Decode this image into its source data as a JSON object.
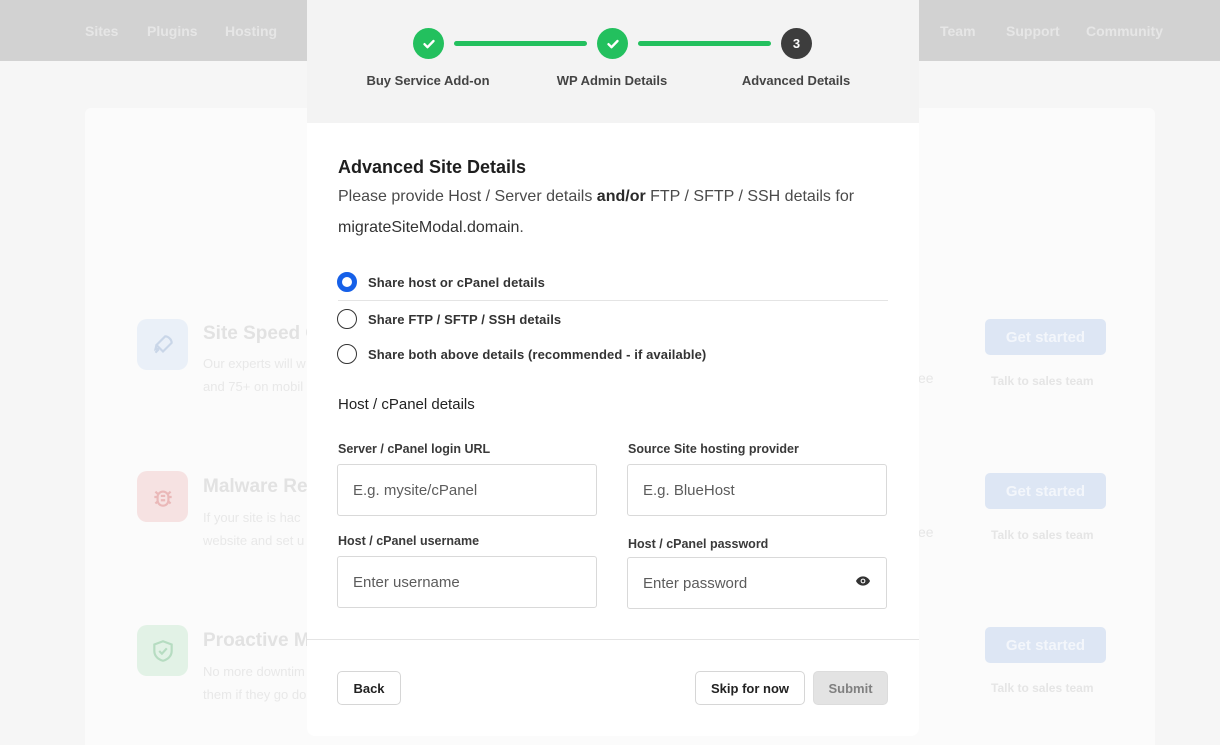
{
  "background": {
    "nav": [
      "Sites",
      "Plugins",
      "Hosting",
      "Team",
      "Support",
      "Community"
    ],
    "services": [
      {
        "title": "Site Speed O",
        "desc1": "Our experts will w",
        "desc2": "and 75+ on mobil",
        "cut": "ee",
        "icon": "rocket-icon",
        "button": "Get started",
        "talk": "Talk to sales team"
      },
      {
        "title": "Malware Rem",
        "desc1": "If your site is hac",
        "desc2": "website and set u",
        "cut": "ee",
        "icon": "bug-icon",
        "button": "Get started",
        "talk": "Talk to sales team"
      },
      {
        "title": "Proactive Mo",
        "desc1": "No more downtim",
        "desc2": "them if they go do",
        "cut": "",
        "icon": "shield-check-icon",
        "button": "Get started",
        "talk": "Talk to sales team"
      }
    ]
  },
  "modal": {
    "steps": [
      {
        "label": "Buy Service Add-on",
        "state": "done"
      },
      {
        "label": "WP Admin Details",
        "state": "done"
      },
      {
        "label": "Advanced Details",
        "state": "current",
        "number": "3"
      }
    ],
    "title": "Advanced Site Details",
    "intro_part1": "Please provide Host / Server details ",
    "intro_bold": "and/or",
    "intro_part2": " FTP / SFTP / SSH details for",
    "domain": "migrateSiteModal.domain",
    "domain_suffix": ".",
    "options": [
      {
        "label": "Share host or cPanel details",
        "checked": true
      },
      {
        "label": "Share FTP / SFTP / SSH details",
        "checked": false
      },
      {
        "label": "Share both above details (recommended - if available)",
        "checked": false
      }
    ],
    "host_section_title": "Host / cPanel details",
    "fields": {
      "login_url": {
        "label": "Server / cPanel login URL",
        "placeholder": "E.g. mysite/cPanel",
        "value": ""
      },
      "provider": {
        "label": "Source Site hosting provider",
        "placeholder": "E.g. BlueHost",
        "value": ""
      },
      "username": {
        "label": "Host / cPanel username",
        "placeholder": "Enter username",
        "value": ""
      },
      "password": {
        "label": "Host / cPanel password",
        "placeholder": "Enter password",
        "value": ""
      }
    },
    "buttons": {
      "back": "Back",
      "skip": "Skip for now",
      "submit": "Submit"
    }
  },
  "colors": {
    "success": "#23c05e",
    "primary": "#1660e8",
    "current_step": "#3d3d3d"
  }
}
